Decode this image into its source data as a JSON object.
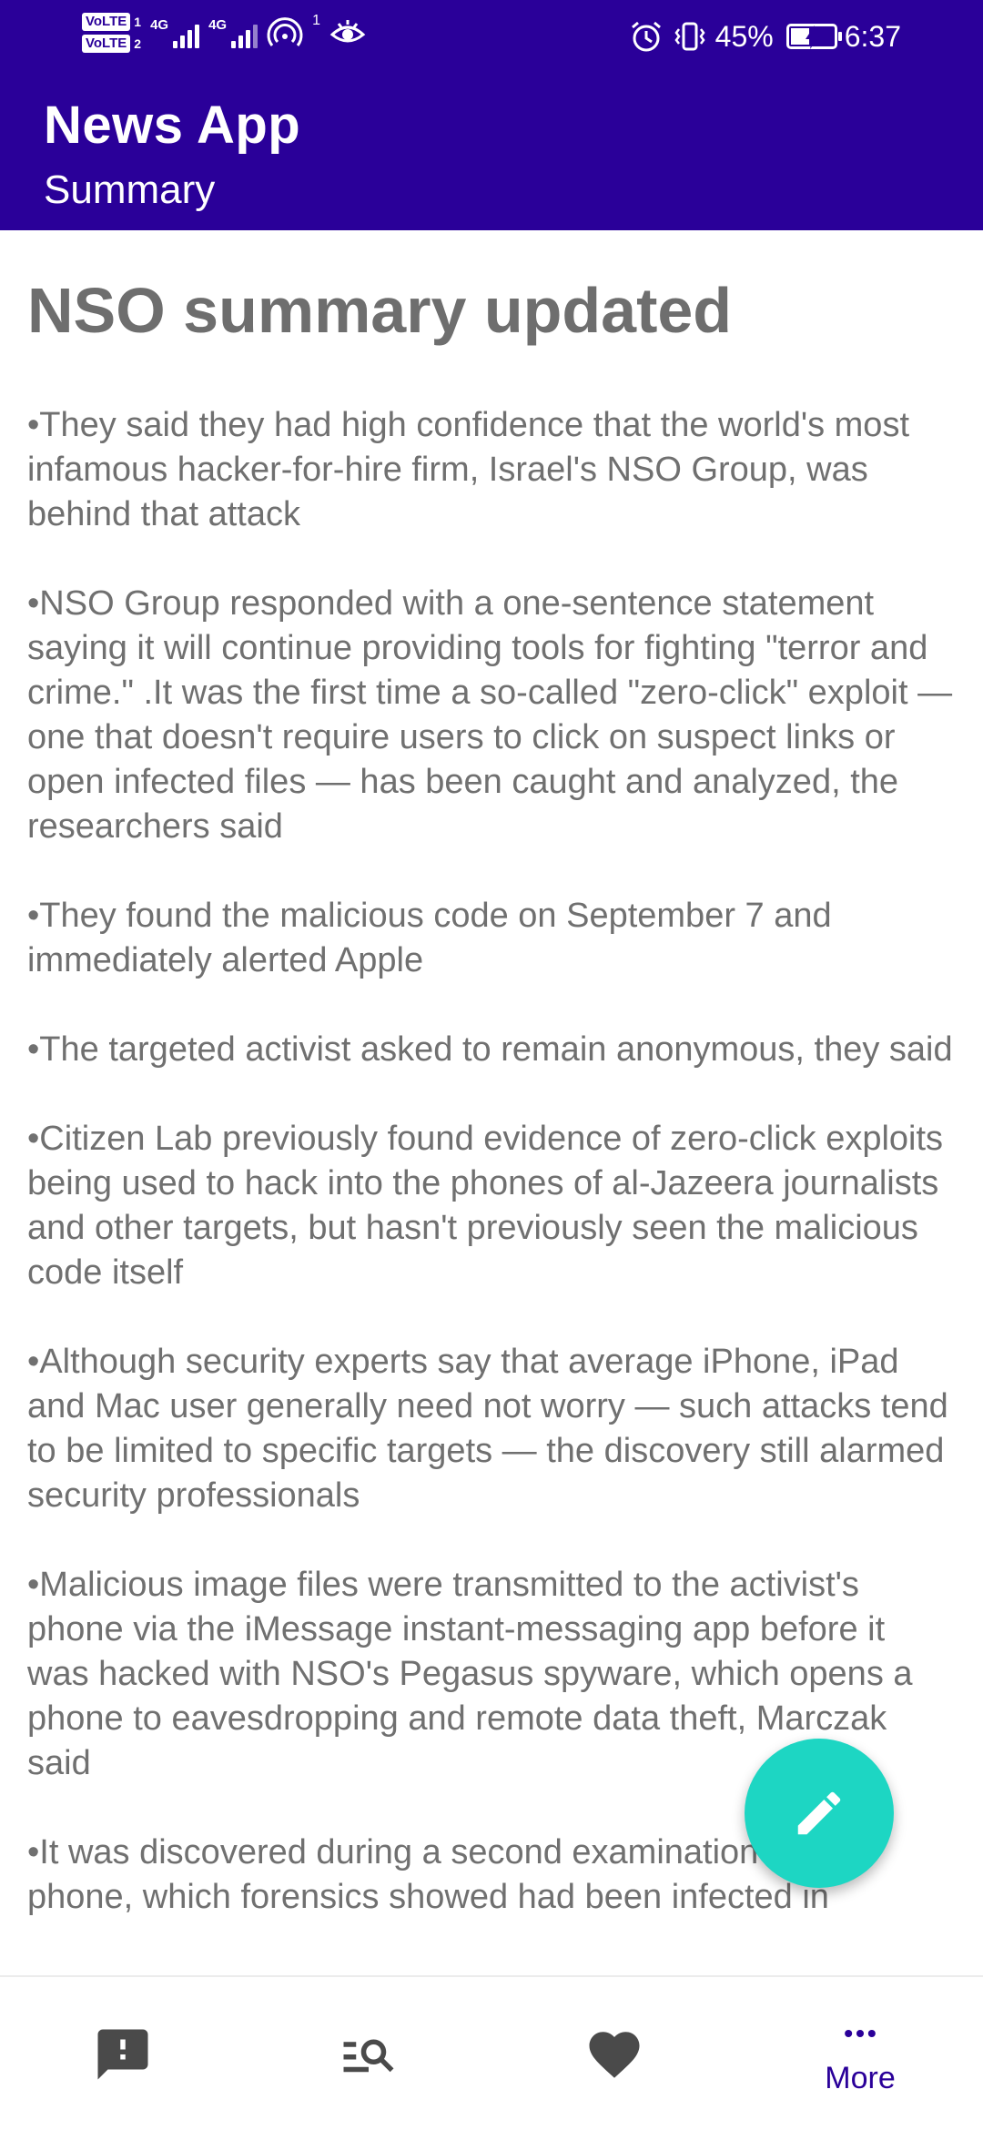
{
  "status_bar": {
    "volte1": "VoLTE",
    "sim1": "1",
    "volte2": "VoLTE",
    "sim2": "2",
    "network1": "4G",
    "network2": "4G",
    "hotspot_count": "1",
    "battery_percent": "45%",
    "battery_level": 0.45,
    "time": "6:37"
  },
  "app_bar": {
    "title": "News App",
    "subtitle": "Summary"
  },
  "article": {
    "headline": "NSO summary updated",
    "bullets": [
      "•They said they had high confidence that the world's most infamous hacker-for-hire firm, Israel's NSO Group, was behind that attack",
      "•NSO Group responded with a one-sentence statement saying it will continue providing tools for fighting \"terror and crime.\" .It was the first time a so-called \"zero-click\" exploit — one that doesn't require users to click on suspect links or open infected files — has been caught and analyzed, the researchers said",
      "•They found the malicious code on September 7 and immediately alerted Apple",
      "•The targeted activist asked to remain anonymous, they said",
      "•Citizen Lab previously found evidence of zero-click exploits being used to hack into the phones of al-Jazeera journalists and other targets, but hasn't previously seen the malicious code itself",
      "•Although security experts say that average iPhone, iPad and Mac user generally need not worry — such attacks tend to be limited to specific targets — the discovery still alarmed security professionals",
      "•Malicious image files were transmitted to the activist's phone via the iMessage instant-messaging app before it was hacked with NSO's Pegasus spyware, which opens a phone to eavesdropping and remote data theft, Marczak said",
      "•It was discovered during a second examination of the phone, which forensics showed had been infected in"
    ]
  },
  "fab": {
    "icon": "pencil-icon"
  },
  "bottom_nav": {
    "items": [
      {
        "icon": "alert-icon",
        "label": ""
      },
      {
        "icon": "search-list-icon",
        "label": ""
      },
      {
        "icon": "heart-icon",
        "label": ""
      },
      {
        "icon": "more-icon",
        "label": "More",
        "active": true
      }
    ]
  },
  "colors": {
    "primary": "#2a0099",
    "accent": "#1dd6c3",
    "body_text": "#707070",
    "icon_inactive": "#4a4a4a"
  }
}
